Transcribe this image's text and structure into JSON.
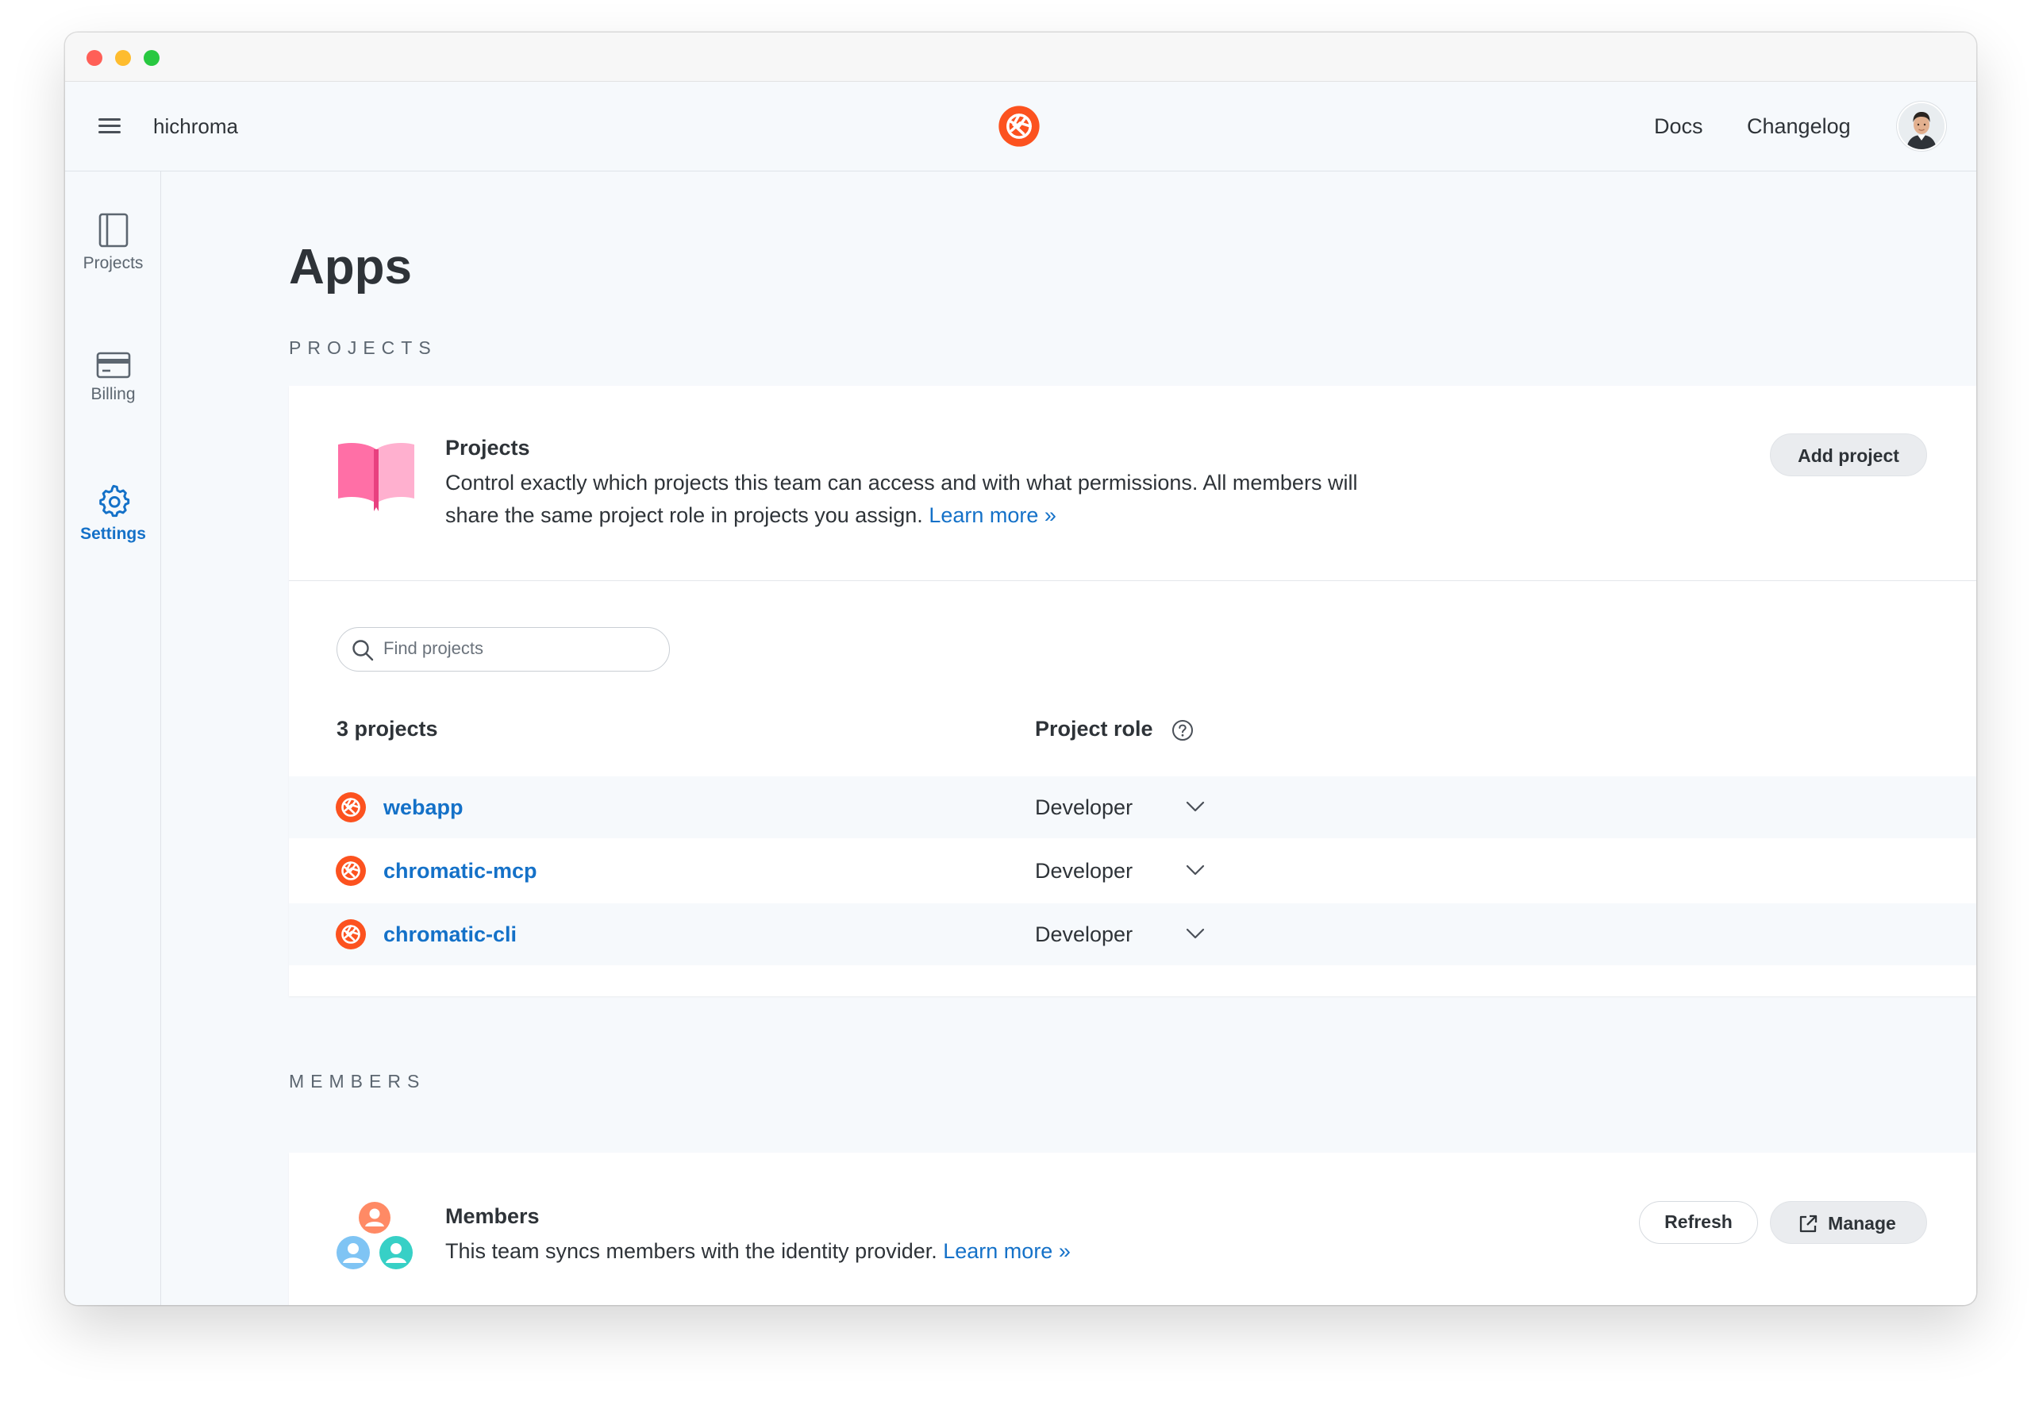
{
  "header": {
    "team_name": "hichroma",
    "nav": {
      "docs": "Docs",
      "changelog": "Changelog"
    }
  },
  "sidebar": {
    "items": [
      {
        "label": "Projects",
        "icon": "book-icon",
        "active": false
      },
      {
        "label": "Billing",
        "icon": "credit-card-icon",
        "active": false
      },
      {
        "label": "Settings",
        "icon": "gear-icon",
        "active": true
      }
    ]
  },
  "page": {
    "title": "Apps"
  },
  "projects_section": {
    "label": "PROJECTS",
    "card_title": "Projects",
    "description": "Control exactly which projects this team can access and with what permissions. All members will share the same project role in projects you assign.",
    "learn_more": "Learn more »",
    "add_button": "Add project",
    "search_placeholder": "Find projects",
    "count_label": "3 projects",
    "role_header": "Project role",
    "rows": [
      {
        "name": "webapp",
        "role": "Developer"
      },
      {
        "name": "chromatic-mcp",
        "role": "Developer"
      },
      {
        "name": "chromatic-cli",
        "role": "Developer"
      }
    ]
  },
  "members_section": {
    "label": "MEMBERS",
    "card_title": "Members",
    "description": "This team syncs members with the identity provider.",
    "learn_more": "Learn more »",
    "refresh_button": "Refresh",
    "manage_button": "Manage"
  },
  "colors": {
    "accent": "#1471c8",
    "brand": "#fc521f",
    "background": "#f6f9fc",
    "book_pink": "#ff7eb0"
  }
}
